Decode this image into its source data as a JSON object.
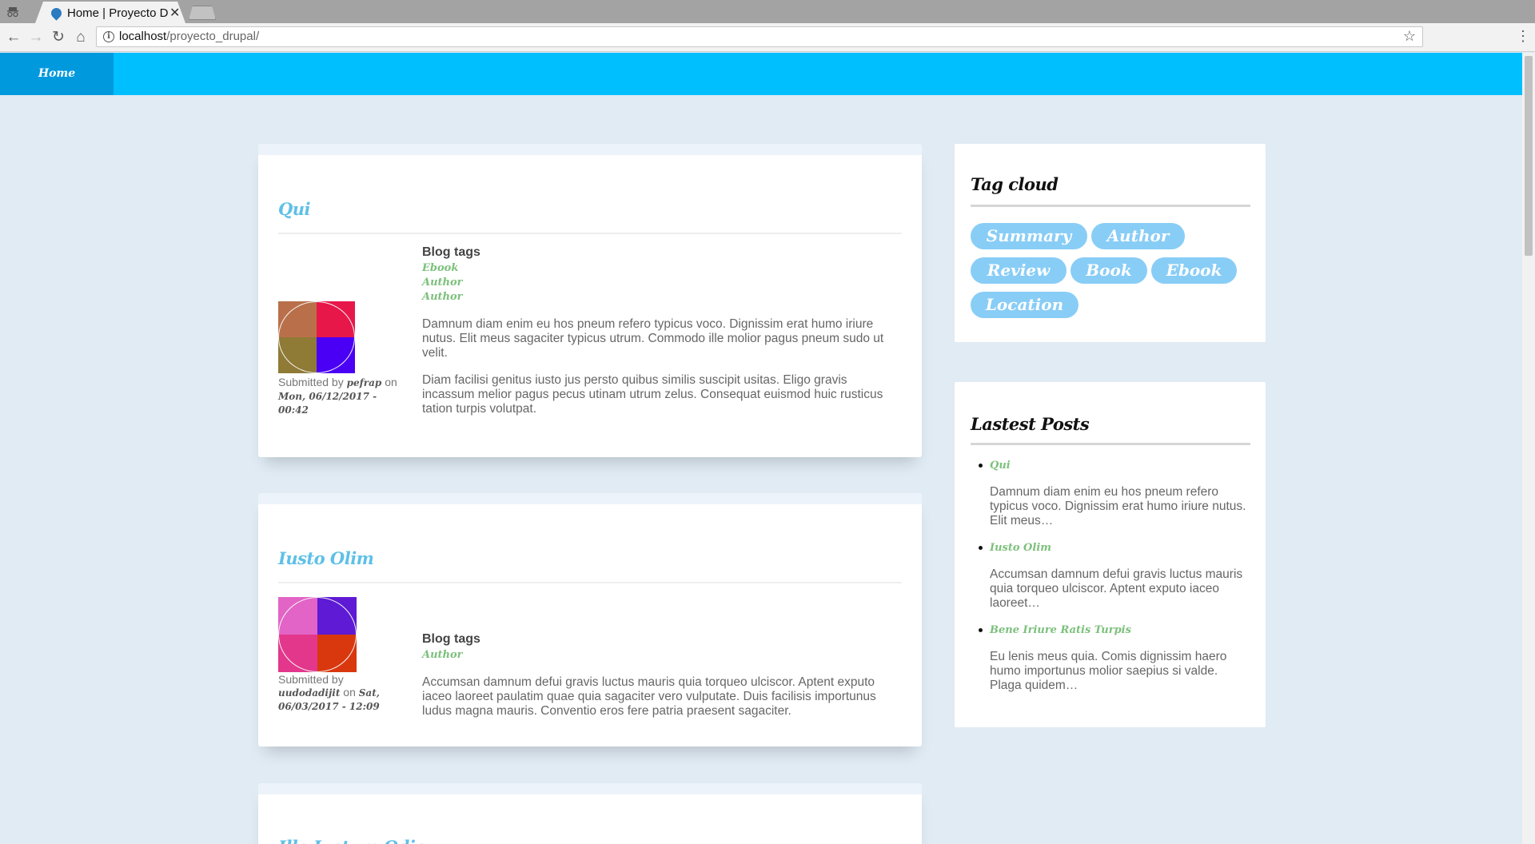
{
  "browser": {
    "tab_title": "Home | Proyecto Drupal",
    "close_glyph": "✕",
    "url_host": "localhost",
    "url_path": "/proyecto_drupal/",
    "back_glyph": "←",
    "forward_glyph": "→",
    "reload_glyph": "↻",
    "home_glyph": "⌂",
    "star_glyph": "☆",
    "menu_glyph": "⋮",
    "info_glyph": "i"
  },
  "nav": {
    "home_label": "Home"
  },
  "posts": [
    {
      "title": "Qui",
      "tags_heading": "Blog tags",
      "tags": [
        "Ebook",
        "Author",
        "Author"
      ],
      "submitted_prefix": "Submitted by",
      "author": "pefrap",
      "on": "on",
      "date": "Mon, 06/12/2017 - 00:42",
      "paragraphs": [
        "Damnum diam enim eu hos pneum refero typicus voco. Dignissim erat humo iriure nutus. Elit meus sagaciter typicus utrum. Commodo ille molior pagus pneum sudo ut velit.",
        "Diam facilisi genitus iusto jus persto quibus similis suscipit usitas. Eligo gravis incassum melior pagus pecus utinam utrum zelus. Consequat euismod huic rusticus tation turpis volutpat."
      ],
      "avatar_colors": [
        "#b9704a",
        "#e8174a",
        "#8f7a36",
        "#4a00f5"
      ]
    },
    {
      "title": "Iusto Olim",
      "tags_heading": "Blog tags",
      "tags": [
        "Author"
      ],
      "submitted_prefix": "Submitted by",
      "author": "uudodadijit",
      "on": "on",
      "date": "Sat, 06/03/2017 - 12:09",
      "paragraphs": [
        "Accumsan damnum defui gravis luctus mauris quia torqueo ulciscor. Aptent exputo iaceo laoreet paulatim quae quia sagaciter vero vulputate. Duis facilisis importunus ludus magna mauris. Conventio eros fere patria praesent sagaciter."
      ],
      "avatar_colors": [
        "#e264c6",
        "#5e1ad4",
        "#e3378c",
        "#d9380f"
      ]
    },
    {
      "title": "Ille Iustum Odio"
    }
  ],
  "sidebar": {
    "tag_cloud": {
      "title": "Tag cloud",
      "tags": [
        "Summary",
        "Author",
        "Review",
        "Book",
        "Ebook",
        "Location"
      ]
    },
    "latest": {
      "title": "Lastest Posts",
      "items": [
        {
          "title": "Qui",
          "excerpt": "Damnum diam enim eu hos pneum refero typicus voco. Dignissim erat humo iriure nutus. Elit meus…"
        },
        {
          "title": "Iusto Olim",
          "excerpt": "Accumsan damnum defui gravis luctus mauris quia torqueo ulciscor. Aptent exputo iaceo laoreet…"
        },
        {
          "title": "Bene Iriure Ratis Turpis",
          "excerpt": "Eu lenis meus quia. Comis dignissim haero humo importunus molior saepius si valde. Plaga quidem…"
        }
      ]
    }
  },
  "colors": {
    "navbar": "#00bfff",
    "nav_active": "#0099dd",
    "post_title": "#5ec0e6",
    "tag_link": "#7cc07c",
    "chip": "#88cdf6",
    "page_bg": "#e0ebf4"
  },
  "icons": [
    "incognito-icon",
    "favicon-icon",
    "close-icon",
    "back-icon",
    "forward-icon",
    "reload-icon",
    "home-icon",
    "info-icon",
    "star-icon",
    "menu-icon"
  ]
}
